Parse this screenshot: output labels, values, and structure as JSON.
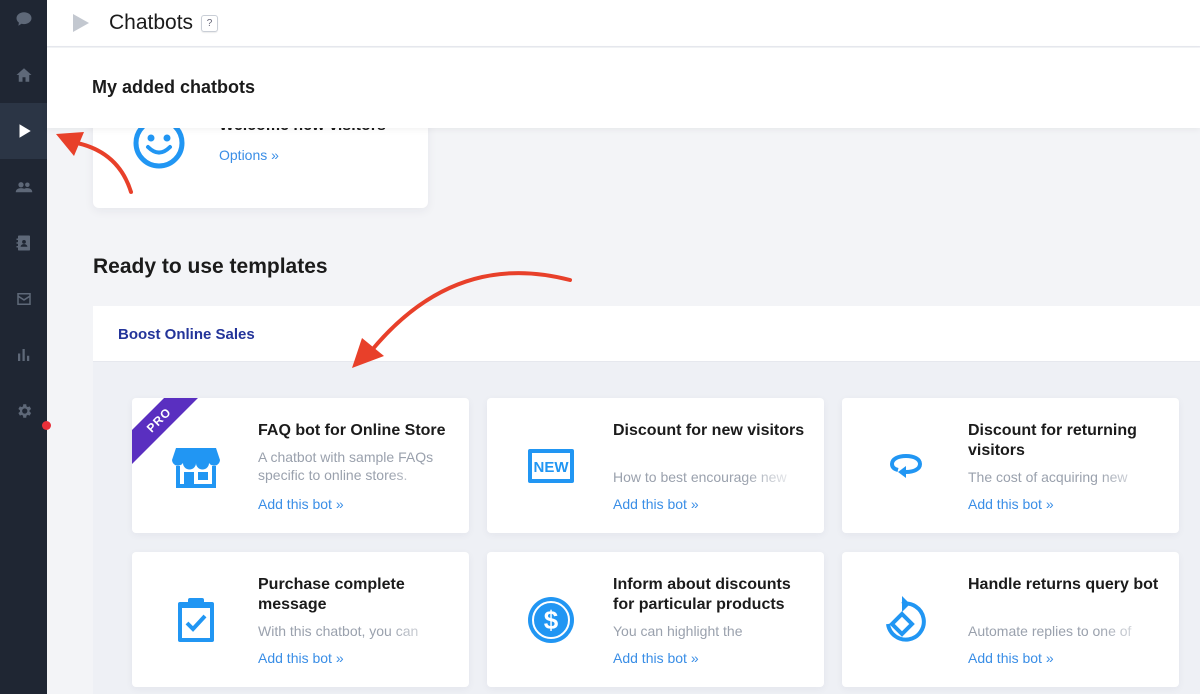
{
  "header": {
    "title": "Chatbots",
    "help": "?"
  },
  "subheader": {
    "title": "My added chatbots"
  },
  "added_bot": {
    "name": "Welcome new visitors",
    "options_label": "Options »"
  },
  "templates": {
    "heading": "Ready to use templates",
    "category": "Boost Online Sales",
    "pro_badge": "PRO",
    "cards": [
      {
        "title": "FAQ bot for Online Store",
        "description_line1": "A chatbot with sample FAQs",
        "description_line2": "specific to online stores.",
        "link": "Add this bot »",
        "icon": "storefront-icon"
      },
      {
        "title": "Discount for new visitors",
        "description_line1": "How to best encourage new",
        "link": "Add this bot »",
        "icon": "new-badge-icon"
      },
      {
        "title": "Discount for returning visitors",
        "description_line1": "The cost of acquiring new",
        "link": "Add this bot »",
        "icon": "return-cycle-icon"
      },
      {
        "title": "Purchase complete message",
        "description_line1": "With this chatbot, you can",
        "link": "Add this bot »",
        "icon": "clipboard-check-icon"
      },
      {
        "title": "Inform about discounts for particular products",
        "description_line1": "You can highlight the",
        "link": "Add this bot »",
        "icon": "dollar-coin-icon"
      },
      {
        "title": "Handle returns query bot",
        "description_line1": "Automate replies to one of",
        "link": "Add this bot »",
        "icon": "returns-icon"
      }
    ]
  },
  "colors": {
    "accent": "#3a8ee6",
    "icon_blue": "#2196f3",
    "category": "#23349a",
    "pro": "#5a2fc0",
    "arrow": "#e8402a"
  }
}
